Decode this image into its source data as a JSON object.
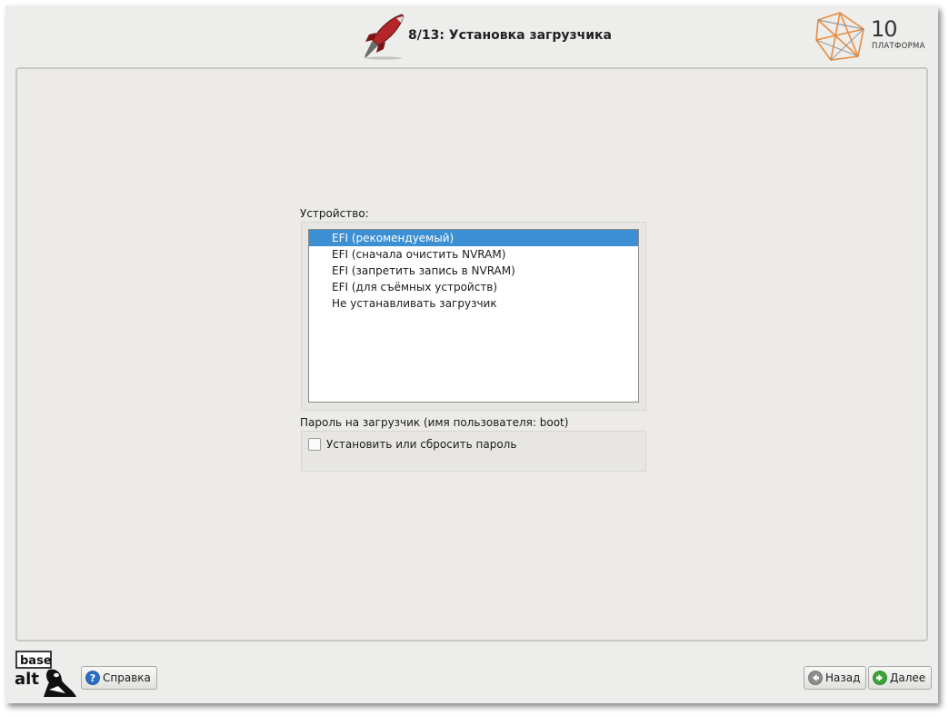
{
  "header": {
    "step_title": "8/13: Установка загрузчика",
    "platform_logo": {
      "number": "10",
      "name": "ПЛАТФОРМА"
    }
  },
  "device": {
    "label": "Устройство:",
    "options": [
      "EFI (рекомендуемый)",
      "EFI (сначала очистить NVRAM)",
      "EFI (запретить запись в NVRAM)",
      "EFI (для съёмных устройств)",
      "Не устанавливать загрузчик"
    ],
    "selected_index": 0
  },
  "password": {
    "label": "Пароль на загрузчик (имя пользователя: boot)",
    "checkbox_label": "Установить или сбросить пароль",
    "checked": false
  },
  "footer": {
    "logo_text_top": "base",
    "logo_text_bottom": "alt",
    "help_label": "Справка",
    "back_label": "Назад",
    "next_label": "Далее"
  },
  "colors": {
    "selection": "#3c8fd2",
    "window_bg": "#ededeb",
    "help_icon": "#2a6fc4",
    "back_icon": "#8c8c8c",
    "next_icon": "#3aa43a"
  },
  "icons": {
    "rocket": "rocket-icon",
    "help": "help-icon",
    "back": "arrow-left-icon",
    "next": "arrow-right-icon"
  }
}
